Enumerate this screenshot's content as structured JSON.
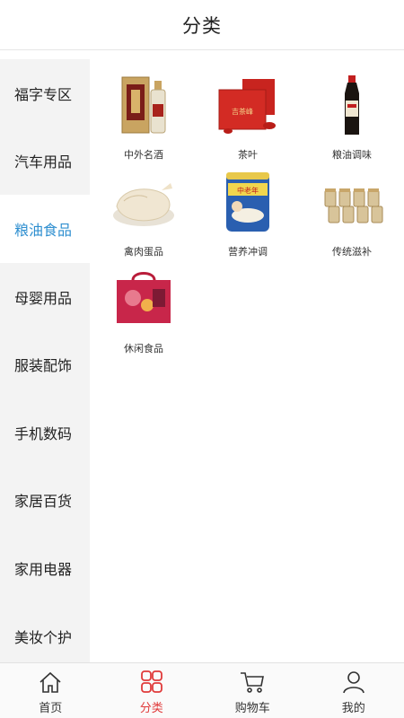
{
  "header": {
    "title": "分类"
  },
  "sidebar": {
    "items": [
      {
        "label": "福字专区"
      },
      {
        "label": "汽车用品"
      },
      {
        "label": "粮油食品",
        "active": true
      },
      {
        "label": "母婴用品"
      },
      {
        "label": "服装配饰"
      },
      {
        "label": "手机数码"
      },
      {
        "label": "家居百货"
      },
      {
        "label": "家用电器"
      },
      {
        "label": "美妆个护"
      }
    ]
  },
  "categories": [
    {
      "label": "中外名酒",
      "icon": "liquor-bottle-box-image"
    },
    {
      "label": "茶叶",
      "icon": "tea-gift-box-image"
    },
    {
      "label": "粮油调味",
      "icon": "soy-sauce-bottle-image"
    },
    {
      "label": "禽肉蛋品",
      "icon": "whole-chicken-image"
    },
    {
      "label": "营养冲调",
      "icon": "milk-powder-can-image"
    },
    {
      "label": "传统滋补",
      "icon": "tonic-jars-image"
    },
    {
      "label": "休闲食品",
      "icon": "snack-gift-box-image"
    }
  ],
  "tabbar": {
    "items": [
      {
        "label": "首页",
        "icon": "home-icon"
      },
      {
        "label": "分类",
        "icon": "grid-icon",
        "active": true
      },
      {
        "label": "购物车",
        "icon": "cart-icon"
      },
      {
        "label": "我的",
        "icon": "person-icon"
      }
    ]
  },
  "colors": {
    "active_side_text": "#2f8fd0",
    "active_tab": "#e03a3a",
    "sidebar_bg": "#f3f3f3"
  }
}
